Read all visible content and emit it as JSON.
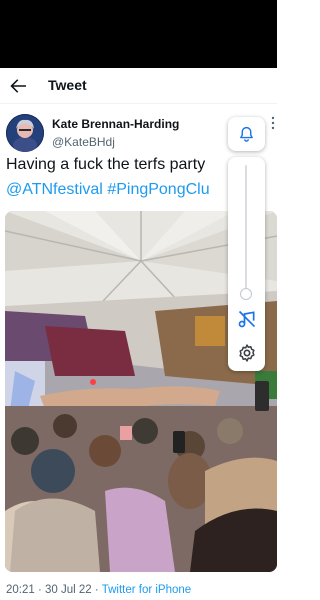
{
  "header": {
    "title": "Tweet",
    "back_icon": "arrow-left-icon"
  },
  "tweet": {
    "author": {
      "display_name": "Kate Brennan-Harding",
      "handle": "@KateBHdj"
    },
    "text_line1": "Having a fuck the terfs party",
    "hashtag_line": {
      "mention": "@ATNfestival",
      "hashtag": "#PingPongClu"
    },
    "timestamp": "20:21 · 30 Jul 22 · ",
    "source": "Twitter for iPhone"
  },
  "volume_panel": {
    "icons": [
      "bell-icon",
      "mute-icon",
      "settings-icon"
    ],
    "volume_level": 0.0
  },
  "colors": {
    "link": "#1d9bf0",
    "text": "#0f1419",
    "secondary": "#536471",
    "status_bar": "#000000"
  }
}
